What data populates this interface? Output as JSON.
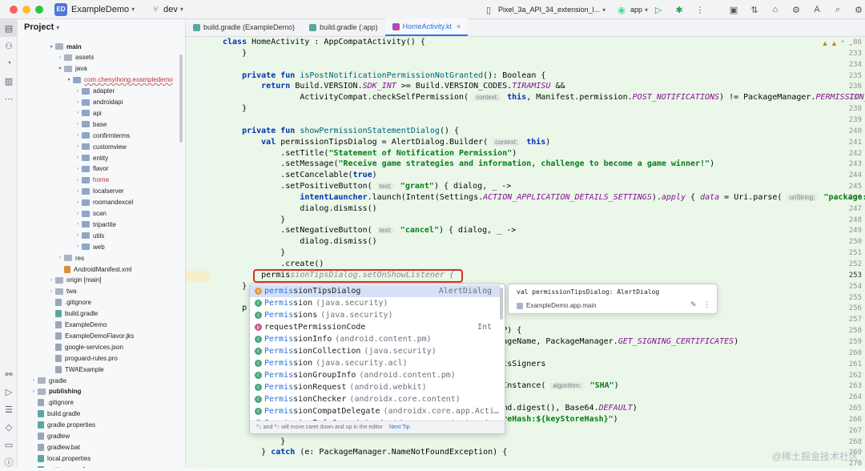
{
  "titlebar": {
    "badge": "ED",
    "project": "ExampleDemo",
    "branch": "dev",
    "device": "Pixel_3a_API_34_extension_l...",
    "run_config": "app"
  },
  "project_panel": {
    "title": "Project",
    "tree": [
      {
        "label": "main",
        "indent": 3,
        "arrow": "▾",
        "icon": "folder",
        "style": "bold"
      },
      {
        "label": "assets",
        "indent": 4,
        "arrow": "›",
        "icon": "folder"
      },
      {
        "label": "java",
        "indent": 4,
        "arrow": "▾",
        "icon": "folder"
      },
      {
        "label": "com.chenyihong.exampledemo",
        "indent": 5,
        "arrow": "▾",
        "icon": "pkg",
        "style": "red-und"
      },
      {
        "label": "adapter",
        "indent": 6,
        "arrow": "›",
        "icon": "pkg"
      },
      {
        "label": "androidapi",
        "indent": 6,
        "arrow": "›",
        "icon": "pkg"
      },
      {
        "label": "api",
        "indent": 6,
        "arrow": "›",
        "icon": "pkg"
      },
      {
        "label": "base",
        "indent": 6,
        "arrow": "›",
        "icon": "pkg"
      },
      {
        "label": "confirmterms",
        "indent": 6,
        "arrow": "›",
        "icon": "pkg"
      },
      {
        "label": "customview",
        "indent": 6,
        "arrow": "›",
        "icon": "pkg"
      },
      {
        "label": "entity",
        "indent": 6,
        "arrow": "›",
        "icon": "pkg"
      },
      {
        "label": "flavor",
        "indent": 6,
        "arrow": "›",
        "icon": "pkg"
      },
      {
        "label": "home",
        "indent": 6,
        "arrow": "›",
        "icon": "pkg",
        "style": "hl"
      },
      {
        "label": "localserver",
        "indent": 6,
        "arrow": "›",
        "icon": "pkg"
      },
      {
        "label": "roomandexcel",
        "indent": 6,
        "arrow": "›",
        "icon": "pkg"
      },
      {
        "label": "scan",
        "indent": 6,
        "arrow": "›",
        "icon": "pkg"
      },
      {
        "label": "tripartite",
        "indent": 6,
        "arrow": "›",
        "icon": "pkg"
      },
      {
        "label": "utils",
        "indent": 6,
        "arrow": "›",
        "icon": "pkg"
      },
      {
        "label": "web",
        "indent": 6,
        "arrow": "›",
        "icon": "pkg"
      },
      {
        "label": "res",
        "indent": 4,
        "arrow": "›",
        "icon": "folder"
      },
      {
        "label": "AndroidManifest.xml",
        "indent": 4,
        "arrow": "",
        "icon": "xml"
      },
      {
        "label": "origin [main]",
        "indent": 3,
        "arrow": "›",
        "icon": "folder"
      },
      {
        "label": "twa",
        "indent": 3,
        "arrow": "›",
        "icon": "folder"
      },
      {
        "label": ".gitignore",
        "indent": 3,
        "arrow": "",
        "icon": "file"
      },
      {
        "label": "build.gradle",
        "indent": 3,
        "arrow": "",
        "icon": "gradle"
      },
      {
        "label": "ExampleDemo",
        "indent": 3,
        "arrow": "",
        "icon": "file"
      },
      {
        "label": "ExampleDemoFlavor.jks",
        "indent": 3,
        "arrow": "",
        "icon": "file"
      },
      {
        "label": "google-services.json",
        "indent": 3,
        "arrow": "",
        "icon": "file"
      },
      {
        "label": "proguard-rules.pro",
        "indent": 3,
        "arrow": "",
        "icon": "file"
      },
      {
        "label": "TWAExample",
        "indent": 3,
        "arrow": "",
        "icon": "file"
      },
      {
        "label": "gradle",
        "indent": 1,
        "arrow": "›",
        "icon": "folder"
      },
      {
        "label": "publishing",
        "indent": 1,
        "arrow": "›",
        "icon": "folder",
        "style": "bold"
      },
      {
        "label": ".gitignore",
        "indent": 1,
        "arrow": "",
        "icon": "file"
      },
      {
        "label": "build.gradle",
        "indent": 1,
        "arrow": "",
        "icon": "gradle"
      },
      {
        "label": "gradle.properties",
        "indent": 1,
        "arrow": "",
        "icon": "gradle"
      },
      {
        "label": "gradlew",
        "indent": 1,
        "arrow": "",
        "icon": "file"
      },
      {
        "label": "gradlew.bat",
        "indent": 1,
        "arrow": "",
        "icon": "file"
      },
      {
        "label": "local.properties",
        "indent": 1,
        "arrow": "",
        "icon": "gradle"
      },
      {
        "label": "settings.gradle",
        "indent": 1,
        "arrow": "",
        "icon": "gradle"
      }
    ]
  },
  "tabs": [
    {
      "label": "build.gradle (ExampleDemo)",
      "icon": "gradle",
      "active": false
    },
    {
      "label": "build.gradle (:app)",
      "icon": "gradle",
      "active": false
    },
    {
      "label": "HomeActivity.kt",
      "icon": "kt",
      "active": true
    }
  ],
  "editor": {
    "line_numbers": [
      "86",
      "233",
      "234",
      "235",
      "236",
      "237",
      "238",
      "239",
      "240",
      "241",
      "242",
      "243",
      "244",
      "245",
      "246",
      "247",
      "248",
      "249",
      "250",
      "251",
      "252",
      "253",
      "254",
      "255",
      "256",
      "257",
      "258",
      "259",
      "260",
      "261",
      "262",
      "263",
      "264",
      "265",
      "266",
      "267",
      "268",
      "269",
      "270"
    ],
    "current_line": "253",
    "lines": [
      [
        {
          "t": "class ",
          "c": "kw"
        },
        {
          "t": "HomeActivity : AppCompatActivity() {"
        }
      ],
      [
        {
          "t": "    }"
        }
      ],
      [
        {
          "t": ""
        }
      ],
      [
        {
          "t": "    private fun ",
          "c": "kw"
        },
        {
          "t": "isPostNotificationPermissionNotGranted",
          "c": "fn"
        },
        {
          "t": "(): Boolean {"
        }
      ],
      [
        {
          "t": "        return ",
          "c": "kw"
        },
        {
          "t": "Build.VERSION."
        },
        {
          "t": "SDK_INT",
          "c": "it"
        },
        {
          "t": " >= Build.VERSION_CODES."
        },
        {
          "t": "TIRAMISU",
          "c": "it"
        },
        {
          "t": " &&"
        }
      ],
      [
        {
          "t": "                ActivityCompat.checkSelfPermission( "
        },
        {
          "t": "context:",
          "c": "hint"
        },
        {
          "t": " this",
          "c": "kw"
        },
        {
          "t": ", Manifest.permission."
        },
        {
          "t": "POST_NOTIFICATIONS",
          "c": "it"
        },
        {
          "t": ") != PackageManager."
        },
        {
          "t": "PERMISSION_GR",
          "c": "it"
        }
      ],
      [
        {
          "t": "    }"
        }
      ],
      [
        {
          "t": ""
        }
      ],
      [
        {
          "t": "    private fun ",
          "c": "kw"
        },
        {
          "t": "showPermissionStatementDialog",
          "c": "fn"
        },
        {
          "t": "() {"
        }
      ],
      [
        {
          "t": "        val ",
          "c": "kw"
        },
        {
          "t": "permissionTipsDialog = AlertDialog.Builder( "
        },
        {
          "t": "context:",
          "c": "hint"
        },
        {
          "t": " this",
          "c": "kw"
        },
        {
          "t": ")"
        }
      ],
      [
        {
          "t": "            .setTitle("
        },
        {
          "t": "\"Statement of Notification Permission\"",
          "c": "str"
        },
        {
          "t": ")"
        }
      ],
      [
        {
          "t": "            .setMessage("
        },
        {
          "t": "\"Receive game strategies and information, challenge to become a game winner!\"",
          "c": "str"
        },
        {
          "t": ")"
        }
      ],
      [
        {
          "t": "            .setCancelable("
        },
        {
          "t": "true",
          "c": "kw"
        },
        {
          "t": ")"
        }
      ],
      [
        {
          "t": "            .setPositiveButton( "
        },
        {
          "t": "text:",
          "c": "hint"
        },
        {
          "t": " \"grant\"",
          "c": "str"
        },
        {
          "t": ") { dialog, _ ->"
        }
      ],
      [
        {
          "t": "                intentLauncher",
          "c": "kw"
        },
        {
          "t": ".launch(Intent(Settings."
        },
        {
          "t": "ACTION_APPLICATION_DETAILS_SETTINGS",
          "c": "it"
        },
        {
          "t": ")."
        },
        {
          "t": "apply",
          "c": "it"
        },
        {
          "t": " { "
        },
        {
          "t": "data",
          "c": "it"
        },
        {
          "t": " = Uri.parse( "
        },
        {
          "t": "uriString:",
          "c": "hint"
        },
        {
          "t": " \"package:$p",
          "c": "str"
        }
      ],
      [
        {
          "t": "                dialog.dismiss()"
        }
      ],
      [
        {
          "t": "            }"
        }
      ],
      [
        {
          "t": "            .setNegativeButton( "
        },
        {
          "t": "text:",
          "c": "hint"
        },
        {
          "t": " \"cancel\"",
          "c": "str"
        },
        {
          "t": ") { dialog, _ ->"
        }
      ],
      [
        {
          "t": "                dialog.dismiss()"
        }
      ],
      [
        {
          "t": "            }"
        }
      ],
      [
        {
          "t": "            .create()"
        }
      ],
      [
        {
          "t": "        permis"
        },
        {
          "t": "sionTipsDialog.setOnShowListener {",
          "c": "gray-it"
        }
      ],
      [
        {
          "t": "    }"
        }
      ],
      [
        {
          "t": ""
        }
      ],
      [
        {
          "t": "    p"
        }
      ],
      [
        {
          "t": ""
        }
      ],
      [
        {
          "t": "                                                        S.P) {"
        }
      ],
      [
        {
          "t": "                                                        ckageName, PackageManager."
        },
        {
          "t": "GET_SIGNING_CERTIFICATES",
          "c": "it"
        },
        {
          "t": ")"
        }
      ],
      [
        {
          "t": ""
        }
      ],
      [
        {
          "t": "                                                        entsSigners"
        }
      ],
      [
        {
          "t": ""
        }
      ],
      [
        {
          "t": "                                                        etInstance( "
        },
        {
          "t": "algorithm:",
          "c": "hint"
        },
        {
          "t": " \"SHA\"",
          "c": "str"
        },
        {
          "t": ")"
        }
      ],
      [
        {
          "t": ""
        }
      ],
      [
        {
          "t": "                                                        g(md.digest(), Base64."
        },
        {
          "t": "DEFAULT",
          "c": "it"
        },
        {
          "t": ")"
        }
      ],
      [
        {
          "t": "                                                        toreHash:${keyStoreHash}\"",
          "c": "str"
        },
        {
          "t": ")"
        }
      ],
      [
        {
          "t": "                }"
        }
      ],
      [
        {
          "t": "            }"
        }
      ],
      [
        {
          "t": "        } "
        },
        {
          "t": "catch ",
          "c": "kw"
        },
        {
          "t": "(e: PackageManager.NameNotFoundException) {"
        }
      ],
      [
        {
          "t": ""
        }
      ]
    ]
  },
  "completion": {
    "items": [
      {
        "match": "permis",
        "rest": "sionTipsDialog",
        "pkg": "",
        "type": "AlertDialog",
        "icon": "var",
        "selected": true
      },
      {
        "match": "Permis",
        "rest": "sion",
        "pkg": "(java.security)",
        "type": "",
        "icon": "obj"
      },
      {
        "match": "Permis",
        "rest": "sions",
        "pkg": "(java.security)",
        "type": "",
        "icon": "obj"
      },
      {
        "match": "",
        "rest": "requestPermissionCode",
        "pkg": "",
        "type": "Int",
        "icon": "fun"
      },
      {
        "match": "Permis",
        "rest": "sionInfo",
        "pkg": "(android.content.pm)",
        "type": "",
        "icon": "obj"
      },
      {
        "match": "Permis",
        "rest": "sionCollection",
        "pkg": "(java.security)",
        "type": "",
        "icon": "obj"
      },
      {
        "match": "Permis",
        "rest": "sion",
        "pkg": "(java.security.acl)",
        "type": "",
        "icon": "obj"
      },
      {
        "match": "Permis",
        "rest": "sionGroupInfo",
        "pkg": "(android.content.pm)",
        "type": "",
        "icon": "obj"
      },
      {
        "match": "Permis",
        "rest": "sionRequest",
        "pkg": "(android.webkit)",
        "type": "",
        "icon": "obj"
      },
      {
        "match": "Permis",
        "rest": "sionChecker",
        "pkg": "(androidx.core.content)",
        "type": "",
        "icon": "obj"
      },
      {
        "match": "Permis",
        "rest": "sionCompatDelegate",
        "pkg": "(androidx.core.app.Acti…",
        "type": "",
        "icon": "obj"
      },
      {
        "match": "Permis",
        "rest": "sionInfoCompat",
        "pkg": "(androidx.core.content.pm)",
        "type": "",
        "icon": "obj"
      }
    ],
    "footer_hint": "^↓ and ^↑ will move caret down and up in the editor",
    "footer_tip": "Next Tip"
  },
  "doc_popup": {
    "signature": "val permissionTipsDialog: AlertDialog",
    "location": "ExampleDemo.app.main"
  },
  "watermark": "@稀土掘金技术社区",
  "colors": {
    "editor_bg": "#eaf7e9",
    "highlight_box": "#d93025",
    "accent": "#3574f0"
  }
}
